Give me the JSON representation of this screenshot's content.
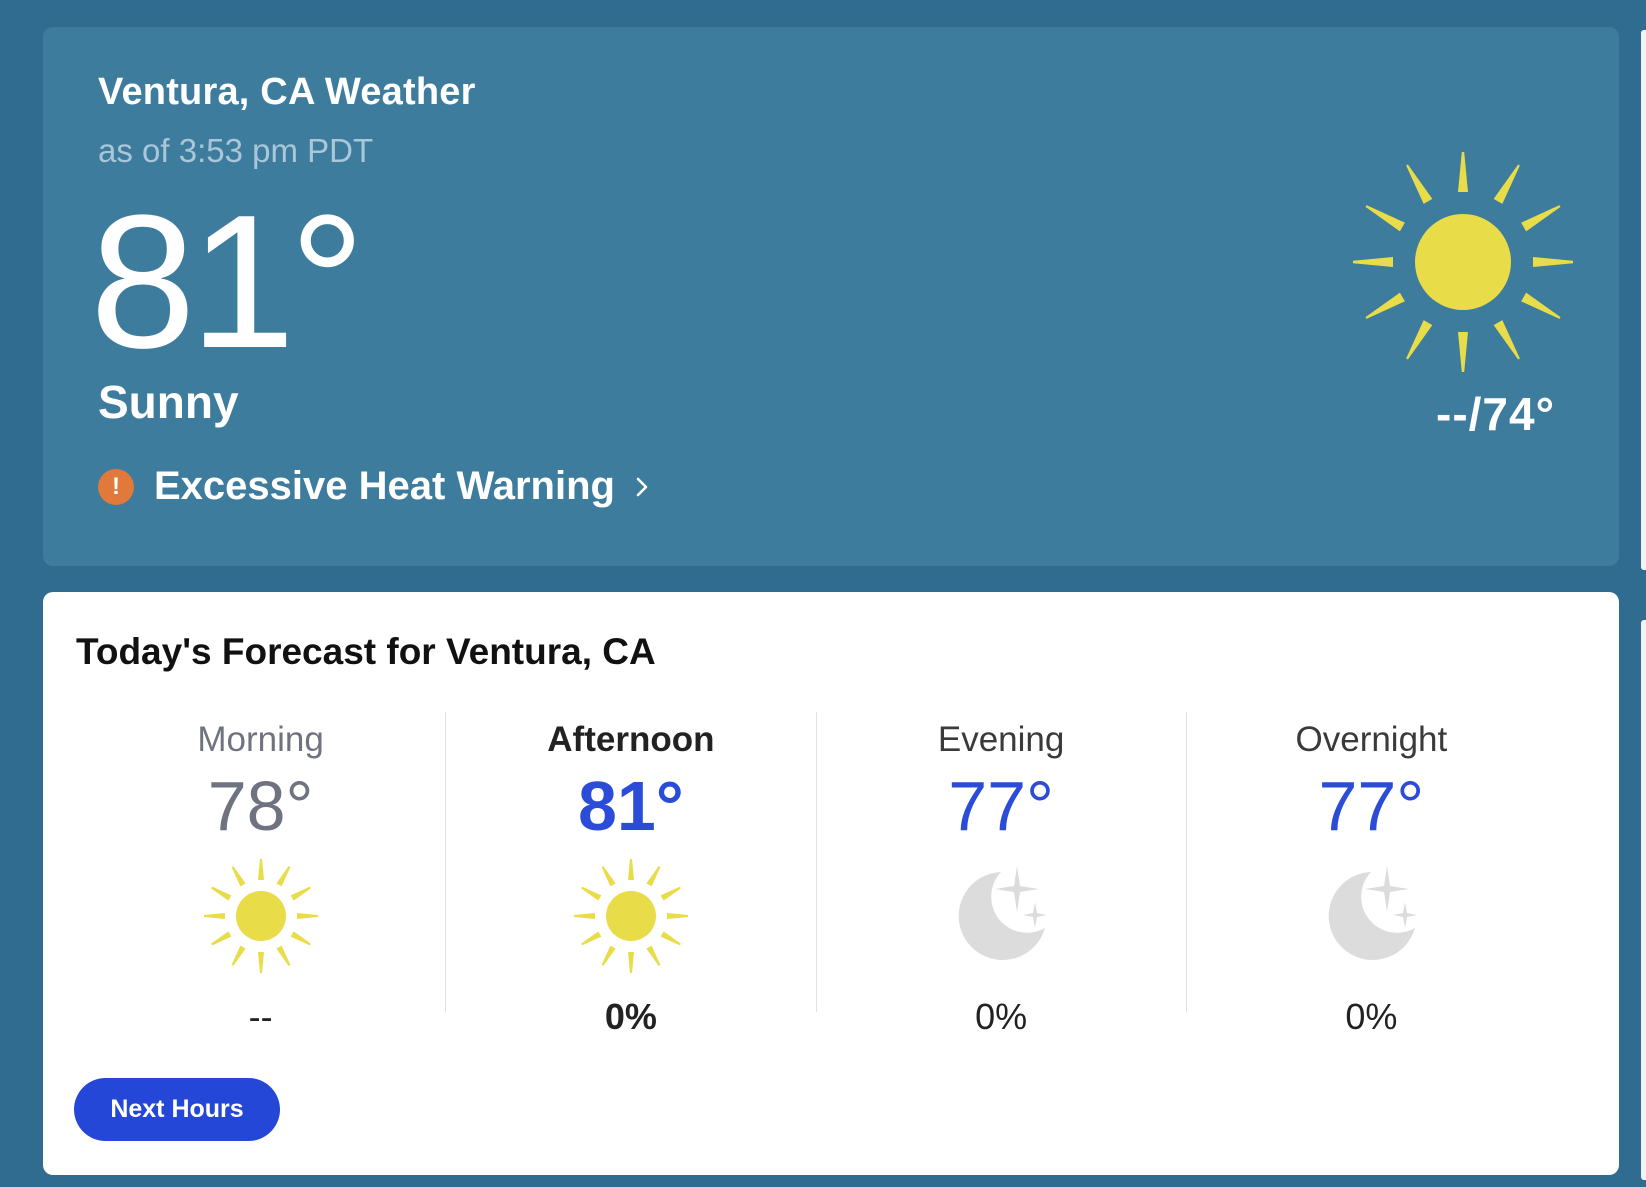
{
  "current": {
    "location_title": "Ventura, CA Weather",
    "timestamp": "as of 3:53 pm PDT",
    "temperature": "81°",
    "phrase": "Sunny",
    "hi_lo": "--/74°",
    "icon": "sun-icon",
    "alert": {
      "label": "Excessive Heat Warning",
      "icon": "alert-icon",
      "icon_glyph": "!"
    }
  },
  "today": {
    "title": "Today's Forecast for Ventura, CA",
    "periods": [
      {
        "name": "Morning",
        "temp": "78°",
        "precip": "--",
        "icon": "sun-icon"
      },
      {
        "name": "Afternoon",
        "temp": "81°",
        "precip": "0%",
        "icon": "sun-icon"
      },
      {
        "name": "Evening",
        "temp": "77°",
        "precip": "0%",
        "icon": "moon-stars-icon"
      },
      {
        "name": "Overnight",
        "temp": "77°",
        "precip": "0%",
        "icon": "moon-stars-icon"
      }
    ],
    "next_hours_label": "Next Hours"
  },
  "colors": {
    "page_background": "#2f6c8f",
    "current_card": "#3e7c9e",
    "accent_blue": "#2547d8",
    "temp_blue": "#2b4cd9",
    "sun_yellow": "#e8dc48",
    "alert_orange": "#e0793a",
    "moon_gray": "#dcdcdc"
  }
}
